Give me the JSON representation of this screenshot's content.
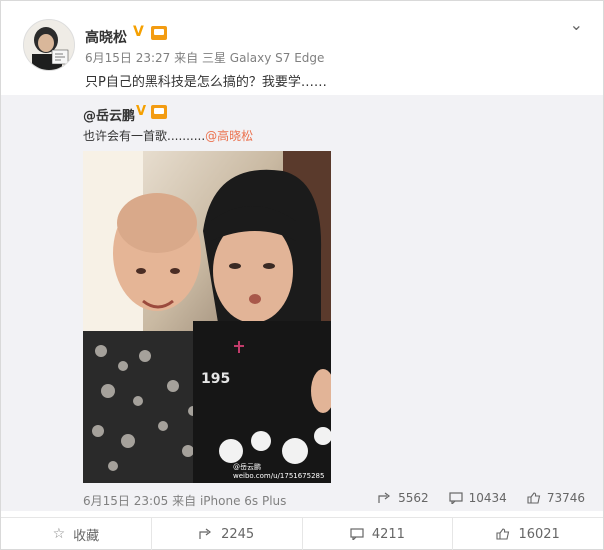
{
  "post": {
    "author": "高晓松",
    "date": "6月15日 23:27",
    "source": "来自 三星 Galaxy S7 Edge",
    "text": "只P自己的黑科技是怎么搞的？我要学……"
  },
  "repost": {
    "author": "@岳云鹏",
    "text_prefix": "也许会有一首歌..........",
    "mention": "@高晓松",
    "date": "6月15日 23:05",
    "source": "来自 iPhone 6s Plus",
    "stats": {
      "forwards": "5562",
      "comments": "10434",
      "likes": "73746"
    },
    "watermark": "weibo.com/u/1751675285",
    "watermark_name": "@岳云鹏"
  },
  "actions": {
    "favorite": "收藏",
    "forward": "2245",
    "comment": "4211",
    "like": "16021"
  },
  "icons": {
    "verified": "v-badge-icon",
    "level": "level-badge-icon",
    "expand": "chevron-down-icon",
    "forward": "forward-icon",
    "comment": "comment-icon",
    "like": "thumbs-up-icon",
    "favorite": "star-icon"
  },
  "colors": {
    "accent": "#eb7350",
    "verified": "#f5a000",
    "repost_bg": "#f2f2f5"
  }
}
